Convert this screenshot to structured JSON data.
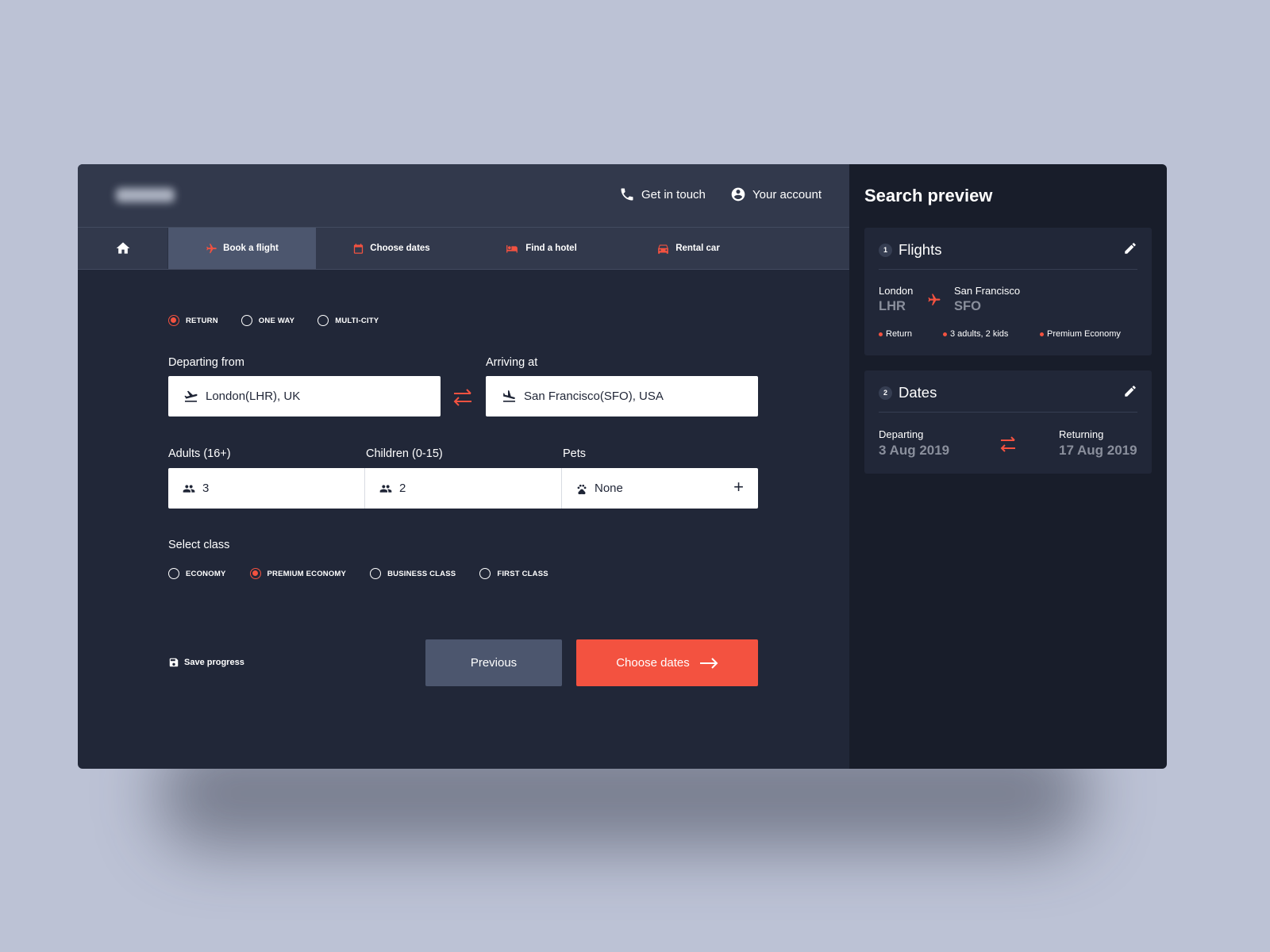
{
  "header": {
    "get_in_touch": "Get in touch",
    "your_account": "Your account"
  },
  "nav": {
    "items": [
      {
        "label": "Book a flight",
        "icon": "plane-icon",
        "active": true
      },
      {
        "label": "Choose dates",
        "icon": "calendar-icon"
      },
      {
        "label": "Find a hotel",
        "icon": "bed-icon"
      },
      {
        "label": "Rental car",
        "icon": "car-icon"
      }
    ]
  },
  "trip_type": {
    "options": [
      "RETURN",
      "ONE WAY",
      "MULTI-CITY"
    ],
    "selected": "RETURN"
  },
  "route": {
    "from_label": "Departing from",
    "from_value": "London(LHR), UK",
    "to_label": "Arriving at",
    "to_value": "San Francisco(SFO), USA"
  },
  "passengers": {
    "adults_label": "Adults (16+)",
    "adults_value": "3",
    "children_label": "Children (0-15)",
    "children_value": "2",
    "pets_label": "Pets",
    "pets_value": "None",
    "add_symbol": "+"
  },
  "travel_class": {
    "label": "Select class",
    "options": [
      "ECONOMY",
      "PREMIUM ECONOMY",
      "BUSINESS CLASS",
      "FIRST CLASS"
    ],
    "selected": "PREMIUM ECONOMY"
  },
  "actions": {
    "save": "Save progress",
    "previous": "Previous",
    "next": "Choose dates"
  },
  "preview": {
    "title": "Search preview",
    "flights": {
      "step": "1",
      "title": "Flights",
      "from_city": "London",
      "from_code": "LHR",
      "to_city": "San Francisco",
      "to_code": "SFO",
      "tags": [
        "Return",
        "3 adults, 2 kids",
        "Premium Economy"
      ]
    },
    "dates": {
      "step": "2",
      "title": "Dates",
      "departing_label": "Departing",
      "departing_value": "3 Aug 2019",
      "returning_label": "Returning",
      "returning_value": "17 Aug 2019"
    }
  },
  "colors": {
    "accent": "#f35240",
    "main_bg": "#212738",
    "header_bg": "#32394c",
    "side_bg": "#181d2a",
    "active_tab": "#4c566e"
  }
}
